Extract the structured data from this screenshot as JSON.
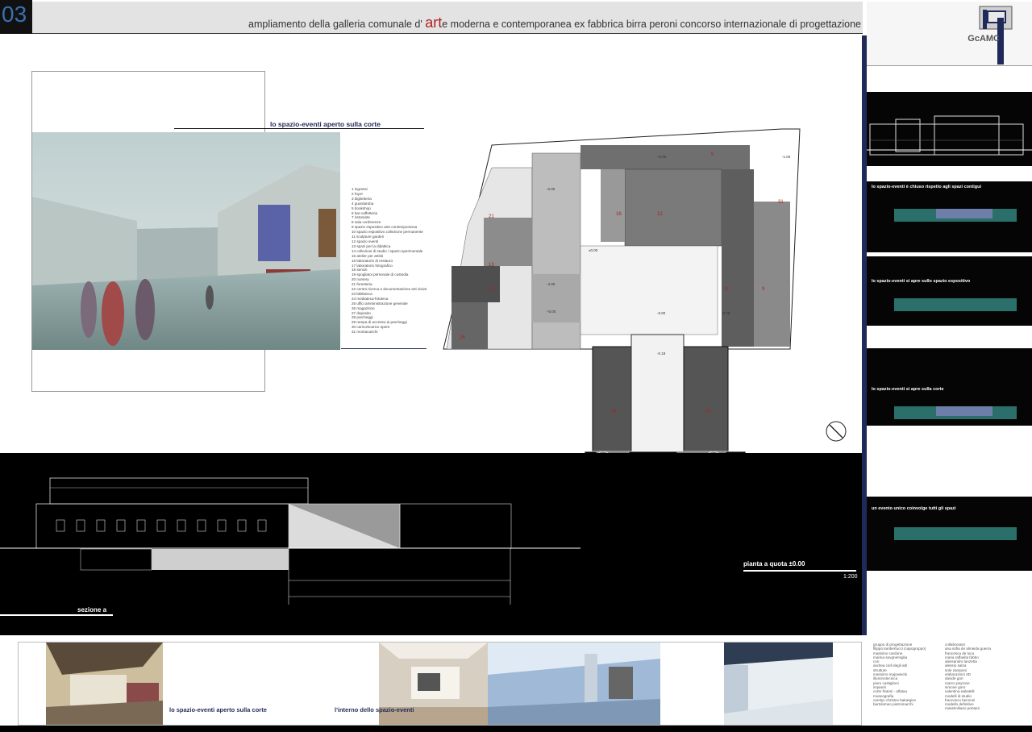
{
  "header": {
    "number": "03",
    "title_before": "ampliamento della galleria comunale d' ",
    "title_art": "art",
    "title_after": "e moderna e contemporanea ex fabbrica birra peroni  concorso internazionale di progettazione",
    "logo": "GcAMC"
  },
  "main": {
    "event_caption": "lo spazio-eventi aperto sulla corte",
    "legend": [
      "1  ingressi",
      "2  foyer",
      "3  biglietteria",
      "4  guardaroba",
      "5  bookshop",
      "6  bar-caffetteria",
      "7  ristorante",
      "8  sala conferenze",
      "9  spazio espositivo arte contemporanea",
      "10 spazio espositivo collezione permanente",
      "11 sculpture garden",
      "12 spazio eventi",
      "13 spazi per la didattica",
      "14 collezioni di studio / spazio sperimentale",
      "15 atelier per artisti",
      "16 laboratorio di restauro",
      "17 laboratorio fotografico",
      "18 servizi",
      "19 spogliatoi personale di custodia",
      "20 nursery",
      "21 foresteria",
      "22 centro ricerca e documentazione arti visive",
      "23 biblioteca",
      "24 mediateca-fototeca",
      "25 uffici amministrazione generale",
      "26 magazzino",
      "27 deposito",
      "28 parcheggi",
      "29 rampa di accesso ai parcheggi",
      "30 carico/scarico opere",
      "31 montacarichi"
    ],
    "section_label": "sezione a",
    "plan_label": "pianta a quota ±0.00",
    "scale": "1:200"
  },
  "plan": {
    "rooms": [
      "9",
      "31",
      "21",
      "18",
      "12",
      "13",
      "19",
      "11",
      "9",
      "26",
      "24",
      "25",
      "22",
      "22"
    ],
    "levels": [
      "+0.00",
      "-0.00",
      "-4.00",
      "±0.00",
      "-0.00",
      "-0.78",
      "-0.18",
      "+0.00",
      "-1.00"
    ]
  },
  "right_panel": {
    "captions": [
      "lo spazio-eventi è chiuso rispetto agli spazi contigui",
      "lo spazio-eventi si apre sullo spazio espositivo",
      "lo spazio-eventi si apre sulla corte",
      "un evento unico coinvolge tutti gli spazi"
    ]
  },
  "bottom": {
    "caption_1": "lo spazio-eventi aperto sulla corte",
    "caption_2": "l'interno dello spazio-eventi",
    "credits_col1": [
      "gruppo di progettazione",
      "filippo lambertucci (capogruppo)",
      "massimo cardone",
      "marina sovgnemiglia",
      "con",
      "andrea ciofi degli atti",
      "",
      "strutture",
      "massimo majowiecki",
      "illuminotecnica",
      "piero castiglioni",
      "impianti",
      "corte fratoni - alfatau",
      "museografia",
      "carolyn christov bakargiev",
      "bartolomeo pietromarchi"
    ],
    "credits_col2": [
      "collaboratori",
      "ana sofia de almeida guerra",
      "francesca de luca",
      "maria raffaella fabbo",
      "alessandro lanzetta",
      "alessio salza",
      "sole zamponi",
      "elaborazioni 3D",
      "davide gori",
      "marco peyrone",
      "simone goro",
      "valentina sabatelli",
      "modelli di studio",
      "francesco benzoni",
      "modello definitivo",
      "massimiliano pontani"
    ]
  }
}
